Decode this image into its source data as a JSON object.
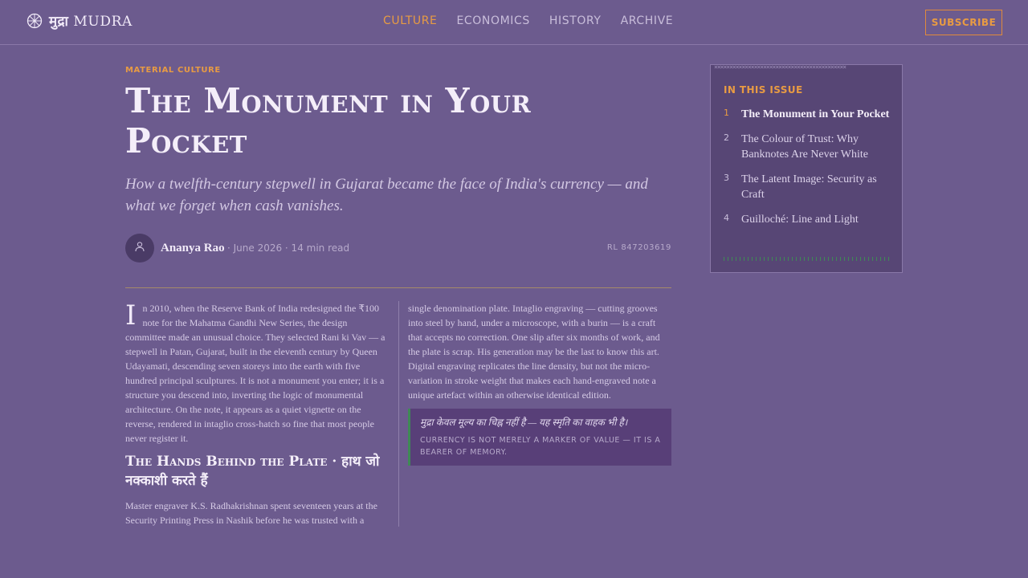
{
  "header": {
    "logo_hindi": "मुद्रा",
    "logo_latin": "MUDRA",
    "nav": [
      {
        "label": "CULTURE",
        "active": true
      },
      {
        "label": "ECONOMICS",
        "active": false
      },
      {
        "label": "HISTORY",
        "active": false
      },
      {
        "label": "ARCHIVE",
        "active": false
      }
    ],
    "subscribe_label": "SUBSCRIBE",
    "logo_icon": "ashoka-wheel-icon"
  },
  "article": {
    "kicker": "MATERIAL CULTURE",
    "title": "The Monument in Your Pocket",
    "dek": "How a twelfth-century stepwell in Gujarat became the face of India's currency — and what we forget when cash vanishes.",
    "author": "Ananya Rao",
    "meta": "· June 2026 · 14 min read",
    "ref": "RL 847203619",
    "dropcap": "I",
    "para1": "n 2010, when the Reserve Bank of India redesigned the ₹100 note for the Mahatma Gandhi New Series, the design committee made an unusual choice. They selected Rani ki Vav — a stepwell in Patan, Gujarat, built in the eleventh century by Queen Udayamati, descending seven storeys into the earth with five hundred principal sculptures. It is not a monument you enter; it is a structure you descend into, inverting the logic of monumental architecture. On the note, it appears as a quiet vignette on the reverse, rendered in intaglio cross-hatch so fine that most people never register it.",
    "subhead": "The Hands Behind the Plate · हाथ जो नक्काशी करते हैं",
    "para2": "Master engraver K.S. Radhakrishnan spent seventeen years at the Security Printing Press in Nashik before he was trusted with a",
    "para3": "single denomination plate. Intaglio engraving — cutting grooves into steel by hand, under a microscope, with a burin — is a craft that accepts no correction. One slip after six months of work, and the plate is scrap. His generation may be the last to know this art. Digital engraving replicates the line density, but not the micro-variation in stroke weight that makes each hand-engraved note a unique artefact within an otherwise identical edition.",
    "quote_hi": "मुद्रा केवल मूल्य का चिह्न नहीं है — यह स्मृति का वाहक भी है।",
    "quote_en": "CURRENCY IS NOT MERELY A MARKER OF VALUE — IT IS A BEARER OF MEMORY."
  },
  "sidebar": {
    "heading": "IN THIS ISSUE",
    "items": [
      {
        "num": "1",
        "label": "The Monument in Your Pocket",
        "current": true
      },
      {
        "num": "2",
        "label": "The Colour of Trust: Why Banknotes Are Never White",
        "current": false
      },
      {
        "num": "3",
        "label": "The Latent Image: Security as Craft",
        "current": false
      },
      {
        "num": "4",
        "label": "Guilloché: Line and Light",
        "current": false
      }
    ]
  },
  "colors": {
    "background": "#6c5b8e",
    "accent": "#e89b43",
    "quote_border": "#3f8a55"
  }
}
